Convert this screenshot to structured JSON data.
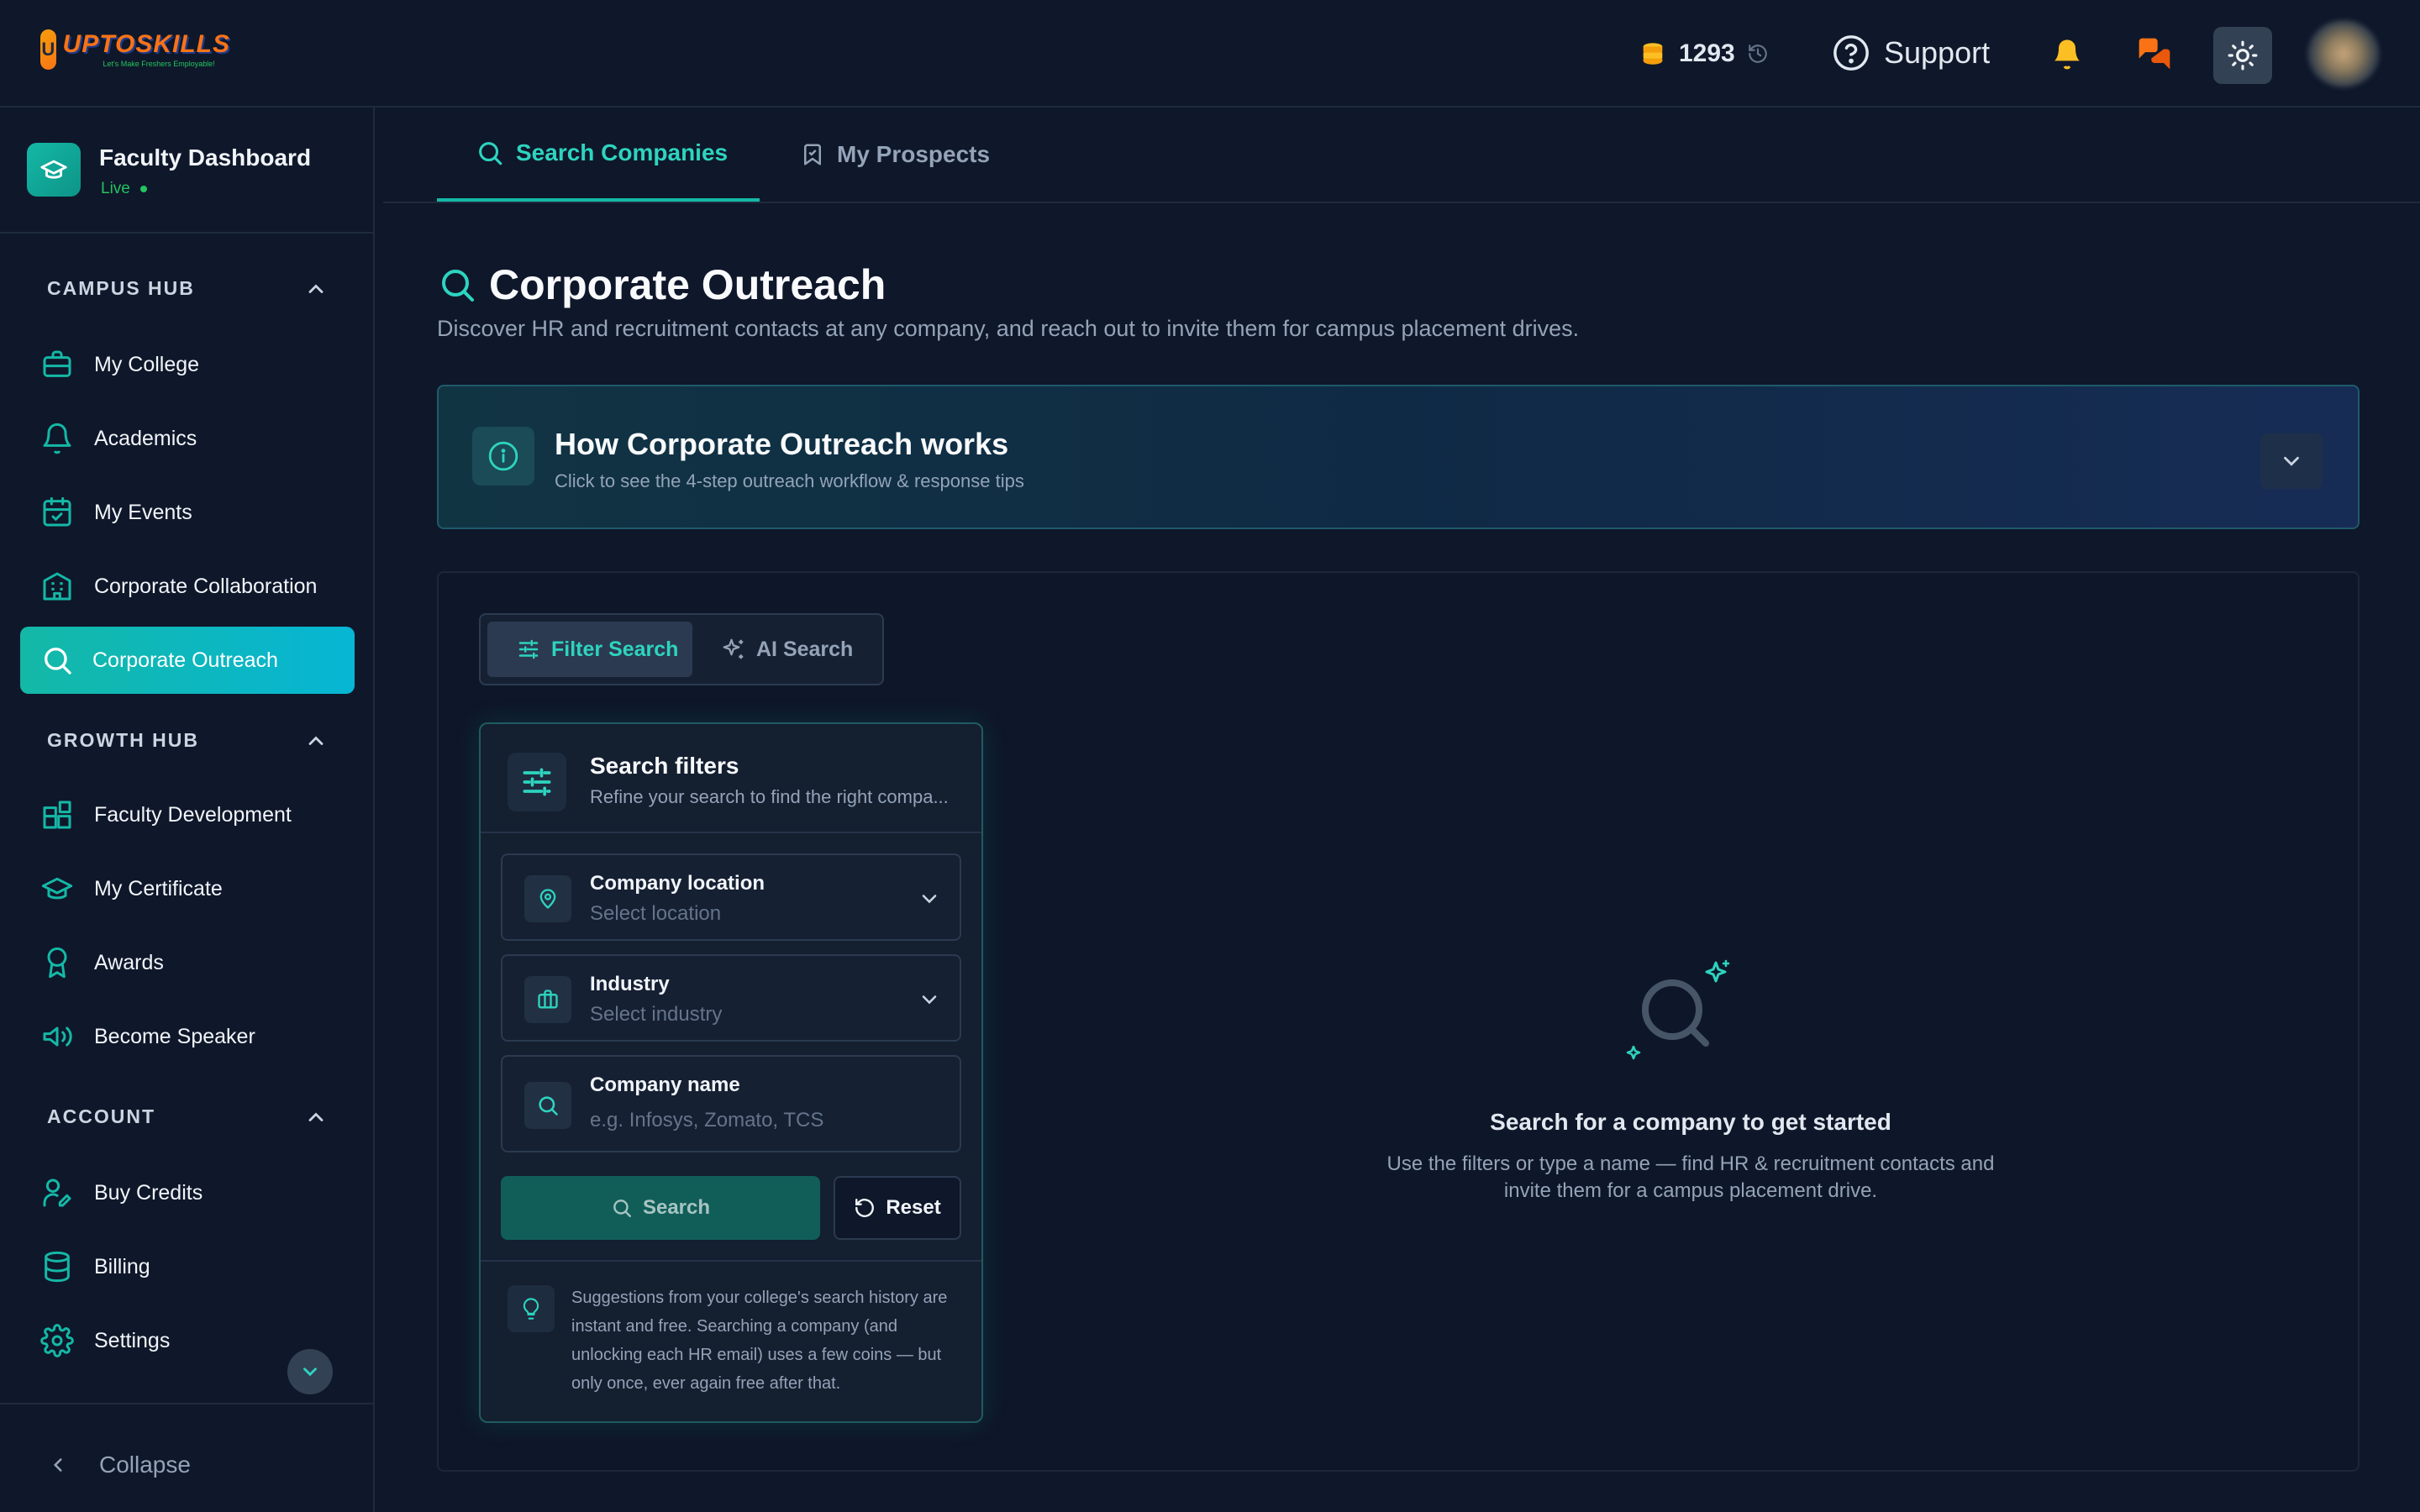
{
  "app": {
    "logo_text": "UPTOSKILLS",
    "logo_tagline": "Let's Make Freshers Employable!"
  },
  "topbar": {
    "coins": "1293",
    "support_label": "Support"
  },
  "sidebar": {
    "header_title": "Faculty Dashboard",
    "header_status": "Live",
    "sections": [
      {
        "title": "CAMPUS HUB",
        "items": [
          {
            "label": "My College",
            "icon": "briefcase-icon"
          },
          {
            "label": "Academics",
            "icon": "bell-icon"
          },
          {
            "label": "My Events",
            "icon": "calendar-check-icon"
          },
          {
            "label": "Corporate Collaboration",
            "icon": "building-icon"
          },
          {
            "label": "Corporate Outreach",
            "icon": "search-icon",
            "active": true
          }
        ]
      },
      {
        "title": "GROWTH HUB",
        "items": [
          {
            "label": "Faculty Development",
            "icon": "blocks-icon"
          },
          {
            "label": "My Certificate",
            "icon": "graduation-cap-icon"
          },
          {
            "label": "Awards",
            "icon": "award-icon"
          },
          {
            "label": "Become Speaker",
            "icon": "megaphone-icon"
          }
        ]
      },
      {
        "title": "ACCOUNT",
        "items": [
          {
            "label": "Buy Credits",
            "icon": "user-pen-icon"
          },
          {
            "label": "Billing",
            "icon": "database-icon"
          },
          {
            "label": "Settings",
            "icon": "gear-icon"
          }
        ]
      }
    ],
    "collapse_label": "Collapse"
  },
  "tabs": [
    {
      "label": "Search Companies",
      "active": true
    },
    {
      "label": "My Prospects",
      "active": false
    }
  ],
  "page": {
    "title": "Corporate Outreach",
    "subtitle": "Discover HR and recruitment contacts at any company, and reach out to invite them for campus placement drives."
  },
  "how_it_works": {
    "title": "How Corporate Outreach works",
    "subtitle": "Click to see the 4-step outreach workflow & response tips"
  },
  "search_modes": {
    "filter_label": "Filter Search",
    "ai_label": "AI Search"
  },
  "filters": {
    "title": "Search filters",
    "subtitle": "Refine your search to find the right compa...",
    "location_label": "Company location",
    "location_value": "Select location",
    "industry_label": "Industry",
    "industry_value": "Select industry",
    "name_label": "Company name",
    "name_placeholder": "e.g. Infosys, Zomato, TCS",
    "search_button": "Search",
    "reset_button": "Reset",
    "tip": "Suggestions from your college's search history are instant and free. Searching a company (and unlocking each HR email) uses a few coins — but only once, ever again free after that."
  },
  "empty_state": {
    "title": "Search for a company to get started",
    "text": "Use the filters or type a name — find HR & recruitment contacts and invite them for a campus placement drive."
  },
  "colors": {
    "background": "#0f172a",
    "accent": "#14b8a6",
    "accent_text": "#2dd4bf",
    "coin": "#fbbf24",
    "bell": "#fbbf24",
    "chat": "#f97316"
  }
}
